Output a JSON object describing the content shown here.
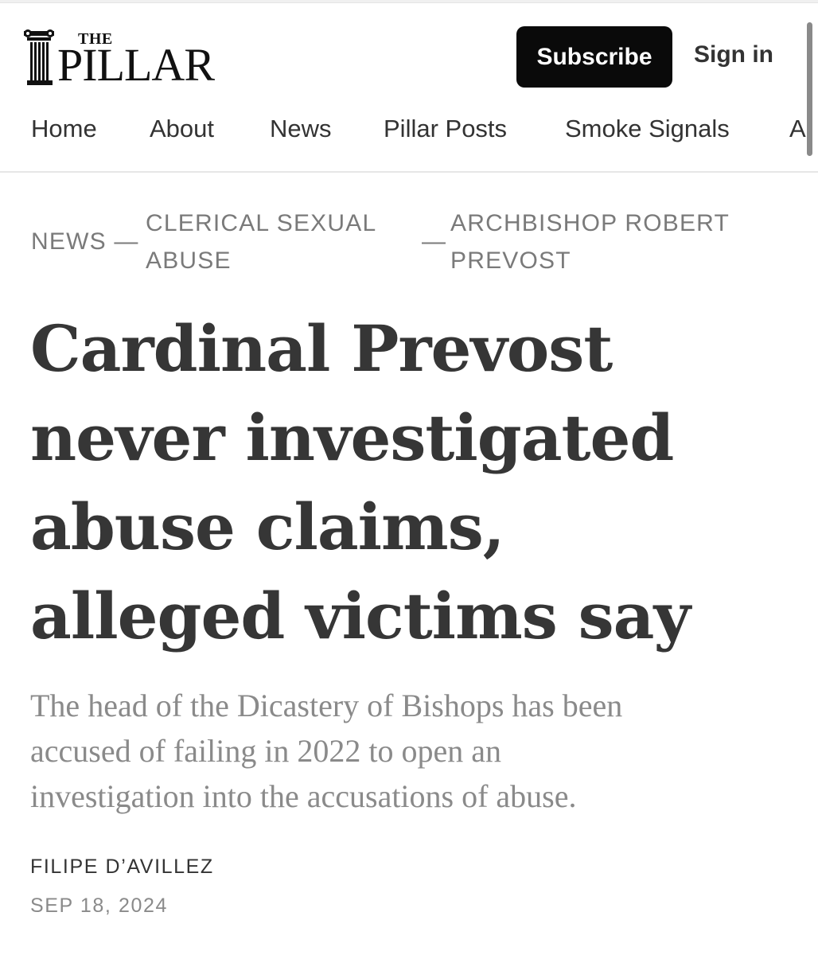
{
  "header": {
    "logo": {
      "small_text": "THE",
      "main_text": "PILLAR"
    },
    "subscribe_label": "Subscribe",
    "signin_label": "Sign in"
  },
  "nav": {
    "items": [
      "Home",
      "About",
      "News",
      "Pillar Posts",
      "Smoke Signals",
      "A"
    ]
  },
  "breadcrumb": {
    "news": "NEWS —",
    "clerical_line1": "CLERICAL SEXUAL",
    "clerical_line2": "ABUSE",
    "sep": "—",
    "archbishop_line1": "ARCHBISHOP ROBERT",
    "archbishop_line2": "PREVOST"
  },
  "article": {
    "headline_lines": [
      "Cardinal Prevost",
      "never investigated",
      "abuse claims,",
      "alleged victims say"
    ],
    "subtitle_lines": [
      "The head of the Dicastery of Bishops has been",
      "accused of failing in 2022 to open an",
      "investigation into the accusations of abuse."
    ],
    "author": "FILIPE D’AVILLEZ",
    "date": "SEP 18, 2024"
  }
}
